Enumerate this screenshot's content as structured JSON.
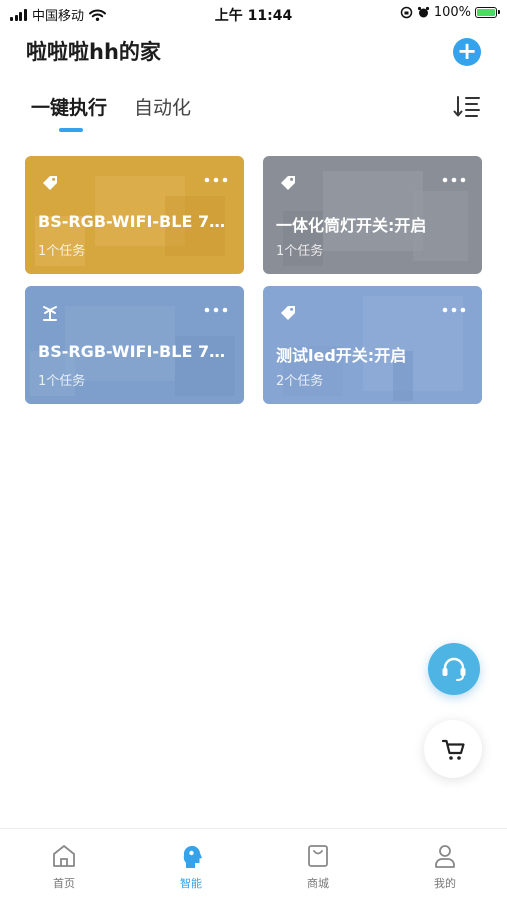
{
  "status_bar": {
    "carrier": "中国移动",
    "time": "上午 11:44",
    "battery_text": "100%",
    "battery_level": 1.0
  },
  "header": {
    "home_name": "啦啦啦hh的家",
    "add_icon": "plus-icon"
  },
  "tabs": {
    "active": "一键执行",
    "inactive": "自动化",
    "sort_icon": "sort-icon"
  },
  "scenes": [
    {
      "name": "BS-RGB-WIFI-BLE 71...",
      "tasks": "1个任务",
      "icon": "tag-icon",
      "color": "#d9a83c"
    },
    {
      "name": "一体化筒灯开关:开启",
      "tasks": "1个任务",
      "icon": "tag-icon",
      "color": "#8b9098"
    },
    {
      "name": "BS-RGB-WIFI-BLE 71...",
      "tasks": "1个任务",
      "icon": "island-icon",
      "color": "#7d9fcc"
    },
    {
      "name": "测试led开关:开启",
      "tasks": "2个任务",
      "icon": "tag-icon",
      "color": "#86a5d4"
    }
  ],
  "floating": {
    "support_icon": "headset-icon",
    "cart_icon": "cart-icon"
  },
  "nav": {
    "items": [
      {
        "label": "首页",
        "icon": "home-icon",
        "active": false
      },
      {
        "label": "智能",
        "icon": "smart-head-icon",
        "active": true
      },
      {
        "label": "商城",
        "icon": "shopping-bag-icon",
        "active": false
      },
      {
        "label": "我的",
        "icon": "person-icon",
        "active": false
      }
    ],
    "active_color": "#35a3ec"
  }
}
